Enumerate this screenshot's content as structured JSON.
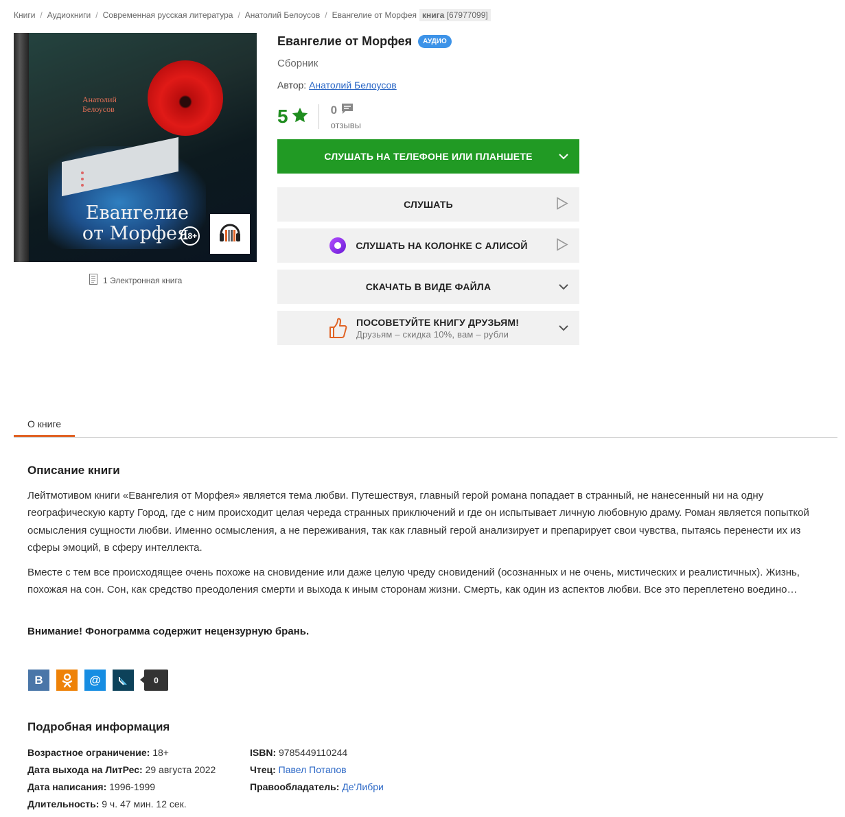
{
  "breadcrumb": {
    "items": [
      "Книги",
      "Аудиокниги",
      "Современная русская литература",
      "Анатолий Белоусов",
      "Евангелие от Морфея"
    ],
    "tag_label": "книга",
    "tag_id": "[67977099]"
  },
  "cover": {
    "author": "Анатолий Белоусов",
    "author_line1": "Анатолий",
    "author_line2": "Белоусов",
    "title_line1": "Евангелие",
    "title_line2": "от Морфея",
    "age": "18+",
    "format_icon": "headphones-icon"
  },
  "ebook_link": "1 Электронная книга",
  "book": {
    "title": "Евангелие от Морфея",
    "badge": "аудио",
    "subtitle": "Сборник",
    "author_label": "Автор:",
    "author_name": "Анатолий Белоусов"
  },
  "rating": {
    "value": "5",
    "reviews_count": "0",
    "reviews_label": "отзывы"
  },
  "buttons": {
    "listen_device": "Слушать на телефоне или планшете",
    "listen": "Слушать",
    "listen_alice": "Слушать на колонке с Алисой",
    "download": "Скачать в виде файла",
    "recommend_title": "Посоветуйте книгу друзьям!",
    "recommend_sub": "Друзьям – скидка 10%, вам – рубли"
  },
  "tabs": [
    "О книге"
  ],
  "description": {
    "heading": "Описание книги",
    "p1": "Лейтмотивом книги «Евангелия от Морфея» является тема любви. Путешествуя, главный герой романа попадает в странный, не нанесенный ни на одну географическую карту Город, где с ним происходит целая череда странных приключений и где он испытывает личную любовную драму. Роман является попыткой осмысления сущности любви. Именно осмысления, а не переживания, так как главный герой анализирует и препарирует свои чувства, пытаясь перенести их из сферы эмоций, в сферу интеллекта.",
    "p2": "Вместе с тем все происходящее очень похоже на сновидение или даже целую чреду сновидений (осознанных и не очень, мистических и реалистичных). Жизнь, похожая на сон. Сон, как средство преодоления смерти и выхода к иным сторонам жизни. Смерть, как один из аспектов любви. Все это переплетено воедино…",
    "warning": "Внимание! Фонограмма содержит нецензурную брань."
  },
  "social": {
    "icons": [
      "vk-icon",
      "odnoklassniki-icon",
      "mailru-icon",
      "livejournal-icon"
    ],
    "vk_glyph": "В",
    "mr_glyph": "@",
    "share_count": "0"
  },
  "details": {
    "heading": "Подробная информация",
    "age_label": "Возрастное ограничение:",
    "age_value": "18+",
    "release_label": "Дата выхода на ЛитРес:",
    "release_value": "29 августа 2022",
    "written_label": "Дата написания:",
    "written_value": "1996-1999",
    "duration_label": "Длительность:",
    "duration_value": "9 ч. 47 мин. 12 сек.",
    "isbn_label": "ISBN:",
    "isbn_value": "9785449110244",
    "reader_label": "Чтец:",
    "reader_value": "Павел Потапов",
    "rights_label": "Правообладатель:",
    "rights_value": "Де'Либри"
  },
  "colors": {
    "green": "#219a24",
    "accent_orange": "#e06325",
    "link_blue": "#2c68c6",
    "badge_blue": "#3d93e8"
  }
}
